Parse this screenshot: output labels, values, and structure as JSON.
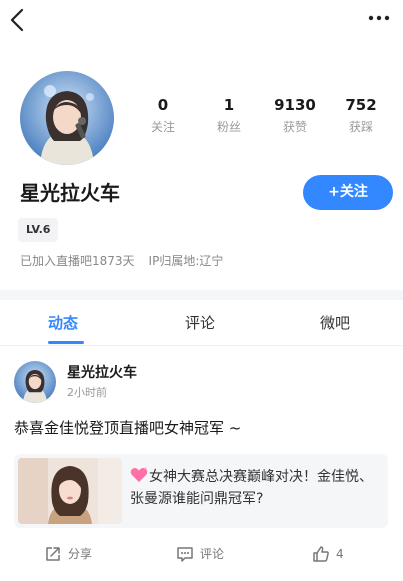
{
  "profile": {
    "username": "星光拉火车",
    "follow_label": "+关注",
    "level": "LV.6",
    "joined": "已加入直播吧1873天",
    "ip_location": "IP归属地:辽宁",
    "stats": [
      {
        "value": "0",
        "label": "关注"
      },
      {
        "value": "1",
        "label": "粉丝"
      },
      {
        "value": "9130",
        "label": "获赞"
      },
      {
        "value": "752",
        "label": "获踩"
      }
    ]
  },
  "tabs": [
    {
      "label": "动态",
      "active": true
    },
    {
      "label": "评论",
      "active": false
    },
    {
      "label": "微吧",
      "active": false
    }
  ],
  "post": {
    "author": "星光拉火车",
    "time": "2小时前",
    "text": "恭喜金佳悦登顶直播吧女神冠军 ~",
    "link_card": {
      "title": "女神大赛总决赛巅峰对决！金佳悦、张曼源谁能问鼎冠军?"
    },
    "actions": {
      "share": "分享",
      "comment": "评论",
      "like_count": "4"
    }
  },
  "colors": {
    "accent": "#3388ff"
  },
  "icons": [
    "back-icon",
    "more-icon",
    "share-icon",
    "comment-icon",
    "like-icon",
    "heart-emoji-icon"
  ]
}
